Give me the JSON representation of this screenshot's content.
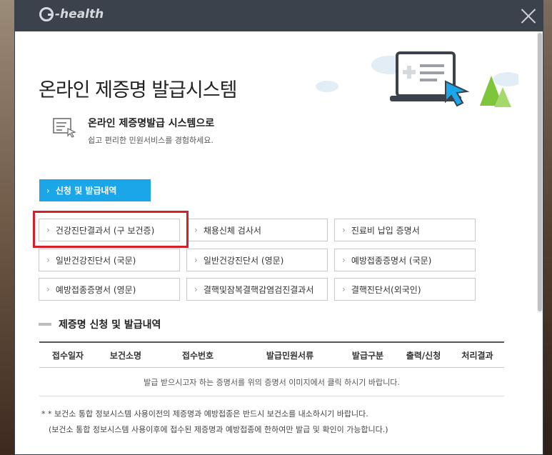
{
  "window": {
    "logo_text": "-health",
    "close_label": "close"
  },
  "header": {
    "title": "온라인 제증명 발급시스템",
    "intro_title": "온라인 제증명발급 시스템으로",
    "intro_subtitle": "쉽고 편리한 민원서비스를 경험하세요."
  },
  "tabs": {
    "active_label": "신청 및 발급내역"
  },
  "certificates": [
    {
      "label": "건강진단결과서 (구 보건증)"
    },
    {
      "label": "채용신체 검사서"
    },
    {
      "label": "진료비 납입 증명서"
    },
    {
      "label": "일반건강진단서 (국문)"
    },
    {
      "label": "일반건강진단서 (영문)"
    },
    {
      "label": "예방접종증명서 (국문)"
    },
    {
      "label": "예방접종증명서 (영문)"
    },
    {
      "label": "결핵및잠복결핵감염검진결과서"
    },
    {
      "label": "결핵진단서(외국인)"
    }
  ],
  "history": {
    "section_title": "제증명 신청 및 발급내역",
    "columns": [
      "접수일자",
      "보건소명",
      "접수번호",
      "발급민원서류",
      "발급구분",
      "출력/신청",
      "처리결과"
    ],
    "empty_message": "발급 받으시고자 하는 증명서를 위의 증명서 이미지에서 클릭 하시기 바랍니다."
  },
  "notes": {
    "note1": "* * 보건소 통합 정보시스템 사용이전의 제증명과 예방접종은 반드시 보건소를 내소하시기 바랍니다.",
    "note2": "(보건소 통합 정보시스템 사용이후에 접수된 제증명과 예방접종에 한하여만 발급 및 확인이 가능합니다.)"
  },
  "colors": {
    "titlebar": "#3b424c",
    "accent": "#1aa6e8",
    "highlight": "#d5202a"
  }
}
